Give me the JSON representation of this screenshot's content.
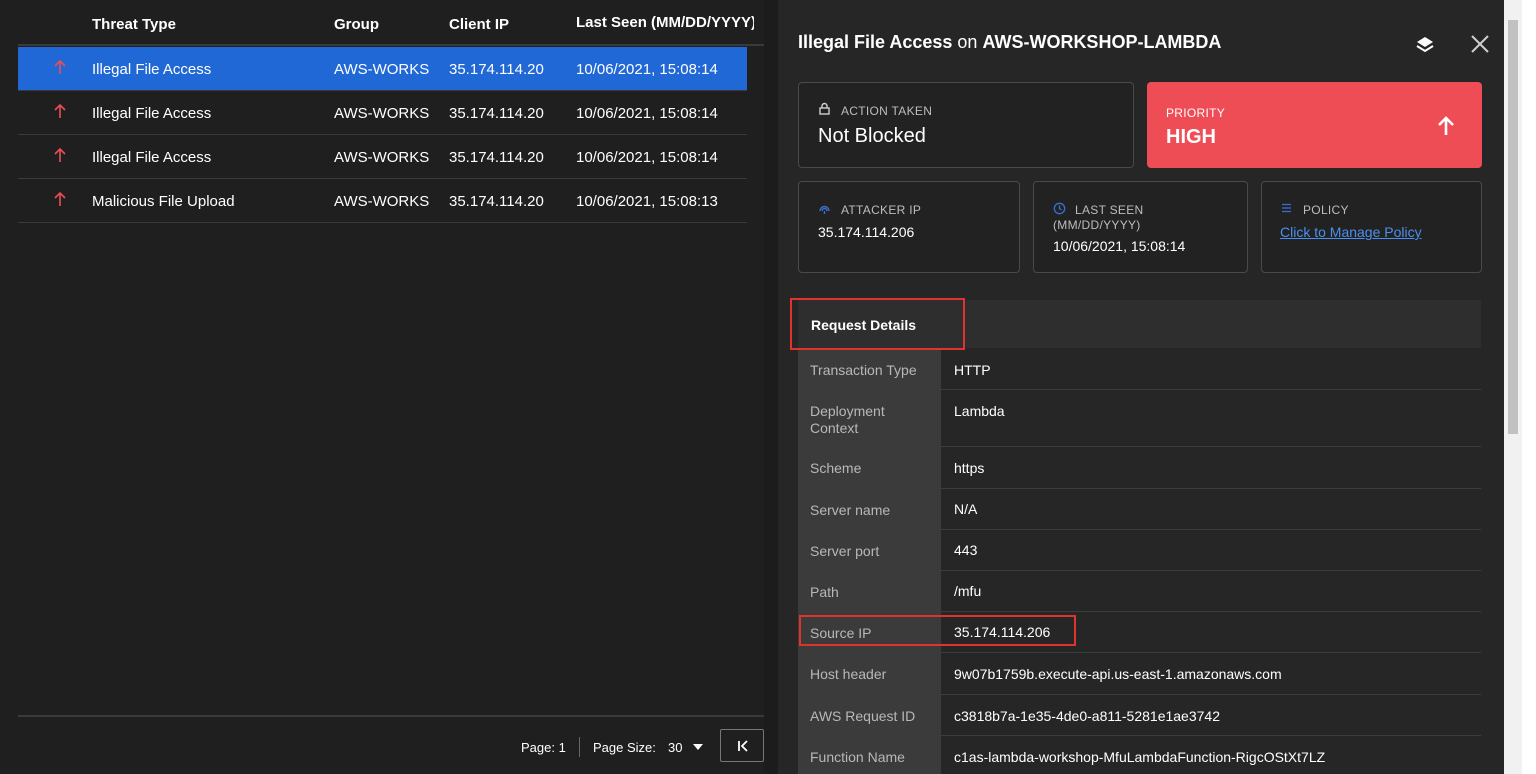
{
  "table": {
    "columns": [
      "Threat Type",
      "Group",
      "Client IP",
      "Last Seen (MM/DD/YYYY)"
    ],
    "rows": [
      {
        "threat": "Illegal File Access",
        "group": "AWS-WORKSI",
        "ip": "35.174.114.20",
        "seen": "10/06/2021, 15:08:14",
        "selected": true
      },
      {
        "threat": "Illegal File Access",
        "group": "AWS-WORKSI",
        "ip": "35.174.114.20",
        "seen": "10/06/2021, 15:08:14",
        "selected": false
      },
      {
        "threat": "Illegal File Access",
        "group": "AWS-WORKSI",
        "ip": "35.174.114.20",
        "seen": "10/06/2021, 15:08:14",
        "selected": false
      },
      {
        "threat": "Malicious File Upload",
        "group": "AWS-WORKSI",
        "ip": "35.174.114.20",
        "seen": "10/06/2021, 15:08:13",
        "selected": false
      }
    ]
  },
  "pager": {
    "page_label": "Page: 1",
    "page_size_label": "Page Size:",
    "page_size_value": "30"
  },
  "panel": {
    "title_threat": "Illegal File Access",
    "title_on": " on ",
    "title_group": "AWS-WORKSHOP-LAMBDA",
    "action": {
      "label": "ACTION TAKEN",
      "value": "Not Blocked"
    },
    "priority": {
      "label": "PRIORITY",
      "value": "HIGH"
    },
    "attacker": {
      "label": "ATTACKER IP",
      "value": "35.174.114.206"
    },
    "last_seen": {
      "label": "LAST SEEN",
      "sublabel": "(MM/DD/YYYY)",
      "value": "10/06/2021, 15:08:14"
    },
    "policy": {
      "label": "POLICY",
      "link": "Click to Manage Policy"
    },
    "request_details_title": "Request Details",
    "details": [
      {
        "key": "Transaction Type",
        "value": "HTTP"
      },
      {
        "key": "Deployment Context",
        "value": "Lambda"
      },
      {
        "key": "Scheme",
        "value": "https"
      },
      {
        "key": "Server name",
        "value": "N/A"
      },
      {
        "key": "Server port",
        "value": "443"
      },
      {
        "key": "Path",
        "value": "/mfu"
      },
      {
        "key": "Source IP",
        "value": "35.174.114.206"
      },
      {
        "key": "Host header",
        "value": "9w07b1759b.execute-api.us-east-1.amazonaws.com"
      },
      {
        "key": "AWS Request ID",
        "value": "c3818b7a-1e35-4de0-a811-5281e1ae3742"
      },
      {
        "key": "Function Name",
        "value": "c1as-lambda-workshop-MfuLambdaFunction-RigcOStXt7LZ"
      }
    ]
  },
  "colors": {
    "accent_selected": "#2168d7",
    "priority_high": "#ee4d55",
    "arrow_red": "#ee4d55",
    "link_blue": "#4a8ff0",
    "highlight_red": "#e0332e"
  }
}
